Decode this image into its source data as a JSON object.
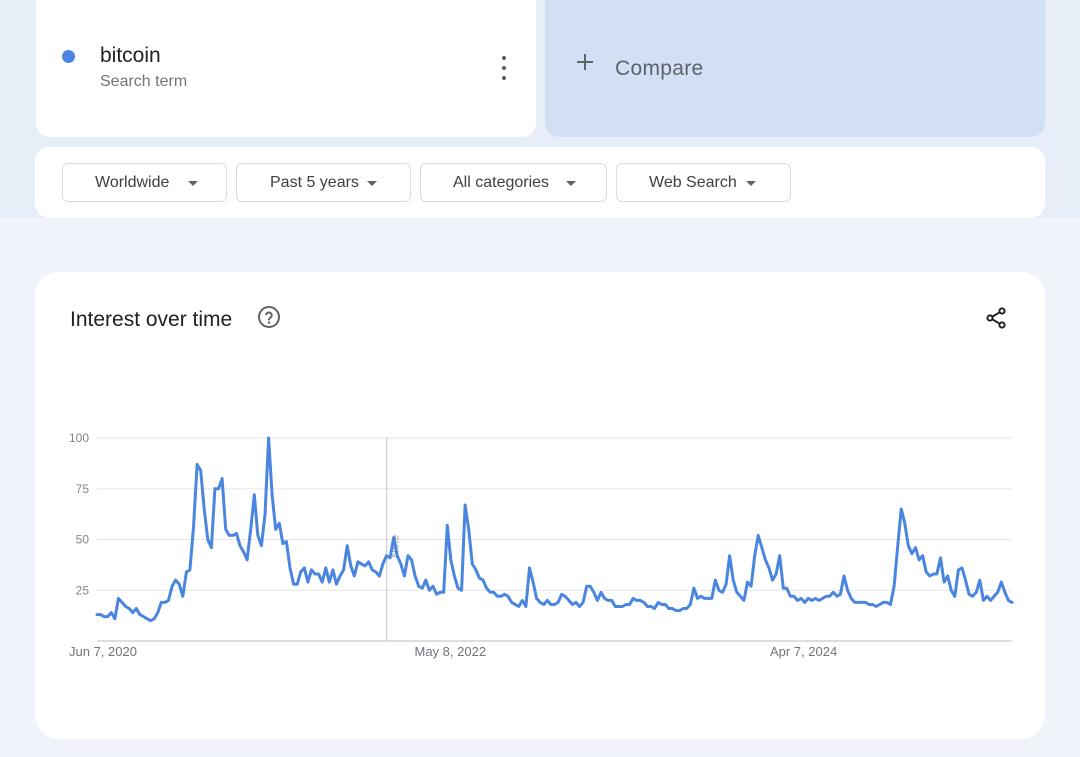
{
  "search_term": {
    "name": "bitcoin",
    "type": "Search term",
    "color": "#4a86e0"
  },
  "compare": {
    "label": "Compare",
    "icon": "plus-icon"
  },
  "filters": [
    {
      "label": "Worldwide"
    },
    {
      "label": "Past 5 years"
    },
    {
      "label": "All categories"
    },
    {
      "label": "Web Search"
    }
  ],
  "chart": {
    "title": "Interest over time",
    "help_icon": "help-circle-icon",
    "share_icon": "share-icon"
  },
  "chart_data": {
    "type": "line",
    "title": "Interest over time",
    "xlabel": "",
    "ylabel": "",
    "ylim": [
      0,
      100
    ],
    "y_ticks": [
      25,
      50,
      75,
      100
    ],
    "x_tick_labels": [
      "Jun 7, 2020",
      "May 8, 2022",
      "Apr 7, 2024"
    ],
    "x_range": [
      "2020-06-07",
      "2025-05-25"
    ],
    "grid": true,
    "annotation": {
      "label": "Note",
      "date": "2022-01-02"
    },
    "color": "#4a86e0",
    "series": [
      {
        "values": [
          13,
          13,
          12,
          12,
          14,
          11,
          21,
          19,
          17,
          16,
          14,
          16,
          13,
          12,
          11,
          10,
          11,
          14,
          19,
          19,
          20,
          27,
          30,
          28,
          22,
          34,
          35,
          56,
          87,
          84,
          65,
          50,
          46,
          75,
          75,
          80,
          55,
          52,
          52,
          53,
          47,
          44,
          40,
          55,
          72,
          52,
          47,
          62,
          100,
          72,
          55,
          58,
          48,
          49,
          36,
          28,
          28,
          34,
          36,
          29,
          35,
          33,
          33,
          29,
          36,
          29,
          35,
          28,
          32,
          35,
          47,
          37,
          32,
          39,
          38,
          37,
          39,
          35,
          34,
          32,
          38,
          42,
          41,
          51,
          42,
          38,
          32,
          42,
          40,
          32,
          27,
          26,
          30,
          25,
          27,
          23,
          24,
          24,
          57,
          40,
          32,
          26,
          25,
          67,
          55,
          38,
          35,
          31,
          30,
          26,
          24,
          24,
          22,
          22,
          23,
          22,
          19,
          18,
          17,
          20,
          17,
          36,
          29,
          21,
          19,
          18,
          20,
          18,
          18,
          19,
          23,
          22,
          20,
          18,
          19,
          17,
          19,
          27,
          27,
          24,
          20,
          24,
          21,
          20,
          20,
          17,
          17,
          17,
          18,
          18,
          21,
          20,
          20,
          19,
          17,
          17,
          16,
          19,
          18,
          18,
          16,
          16,
          15,
          15,
          16,
          16,
          18,
          26,
          21,
          22,
          21,
          21,
          21,
          30,
          25,
          24,
          28,
          42,
          30,
          24,
          22,
          20,
          29,
          27,
          42,
          52,
          46,
          40,
          36,
          30,
          33,
          42,
          26,
          26,
          22,
          22,
          20,
          21,
          19,
          21,
          20,
          21,
          20,
          21,
          22,
          22,
          24,
          22,
          23,
          32,
          25,
          21,
          19,
          19,
          19,
          19,
          18,
          18,
          17,
          18,
          19,
          19,
          18,
          27,
          46,
          65,
          58,
          47,
          43,
          46,
          40,
          42,
          34,
          32,
          33,
          33,
          41,
          29,
          32,
          25,
          22,
          35,
          36,
          30,
          23,
          22,
          24,
          30,
          20,
          22,
          20,
          22,
          24,
          29,
          24,
          20,
          19
        ]
      }
    ]
  }
}
